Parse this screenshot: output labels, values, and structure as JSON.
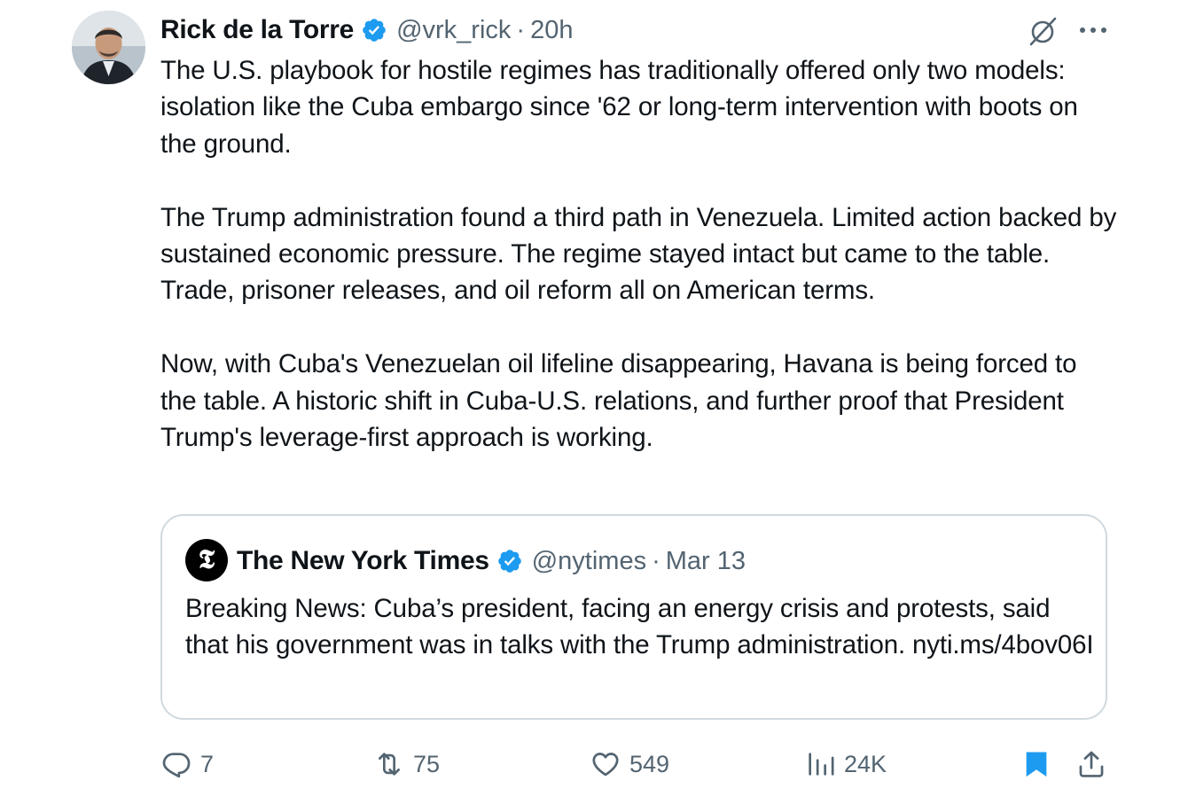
{
  "tweet": {
    "author_name": "Rick de la Torre",
    "handle": "@vrk_rick",
    "separator": "·",
    "time": "20h",
    "text": "The U.S. playbook for hostile regimes has traditionally offered only two models: isolation like the Cuba embargo since '62 or long-term intervention with boots on the ground.\n\nThe Trump administration found a third path in Venezuela. Limited action backed by sustained economic pressure. The regime stayed intact but came to the table. Trade, prisoner releases, and oil reform all on American terms.\n\nNow, with Cuba's Venezuelan oil lifeline disappearing, Havana is being forced to the table. A historic shift in Cuba-U.S. relations, and further proof that President Trump's leverage-first approach is working."
  },
  "quote": {
    "logo_letter": "𝕿",
    "author_name": "The New York Times",
    "handle": "@nytimes",
    "separator": "·",
    "date": "Mar 13",
    "text": "Breaking News: Cuba’s president, facing an energy crisis and protests, said that his government was in talks with the Trump administration. nyti.ms/4bov06I"
  },
  "actions": {
    "replies": "7",
    "reposts": "75",
    "likes": "549",
    "views": "24K"
  },
  "icons": {
    "verified": "verified-badge-icon",
    "grok": "grok-icon",
    "more": "more-icon",
    "reply": "reply-icon",
    "repost": "repost-icon",
    "like": "heart-icon",
    "views": "views-icon",
    "bookmark": "bookmark-icon",
    "share": "share-icon"
  },
  "colors": {
    "text": "#0f1419",
    "secondary": "#536471",
    "verified": "#1d9bf0",
    "border": "#cfd9de",
    "bookmark_active": "#1d9bf0"
  }
}
